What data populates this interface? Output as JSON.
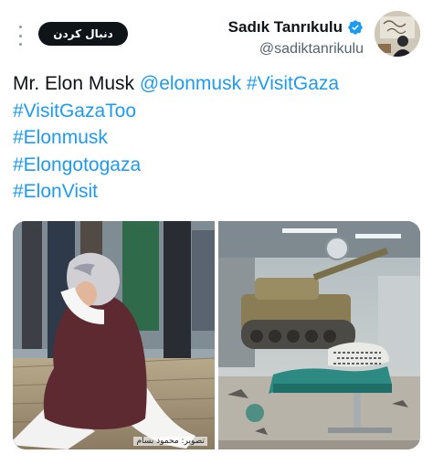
{
  "header": {
    "follow_label": "دنبال کردن",
    "display_name": "Sadık Tanrıkulu",
    "handle": "@sadiktanrikulu",
    "verified_color": "#1d9bf0"
  },
  "tweet": {
    "text_prefix": "Mr. Elon Musk ",
    "mention": "@elonmusk",
    "hashtags": [
      "#VisitGaza",
      "#VisitGazaToo",
      "#Elonmusk",
      "#Elongotogaza",
      "#ElonVisit"
    ]
  },
  "media": {
    "left_caption": "تصویر: محمود بسام"
  },
  "colors": {
    "link": "#1d9bf0",
    "follow_bg": "#0f1419"
  }
}
